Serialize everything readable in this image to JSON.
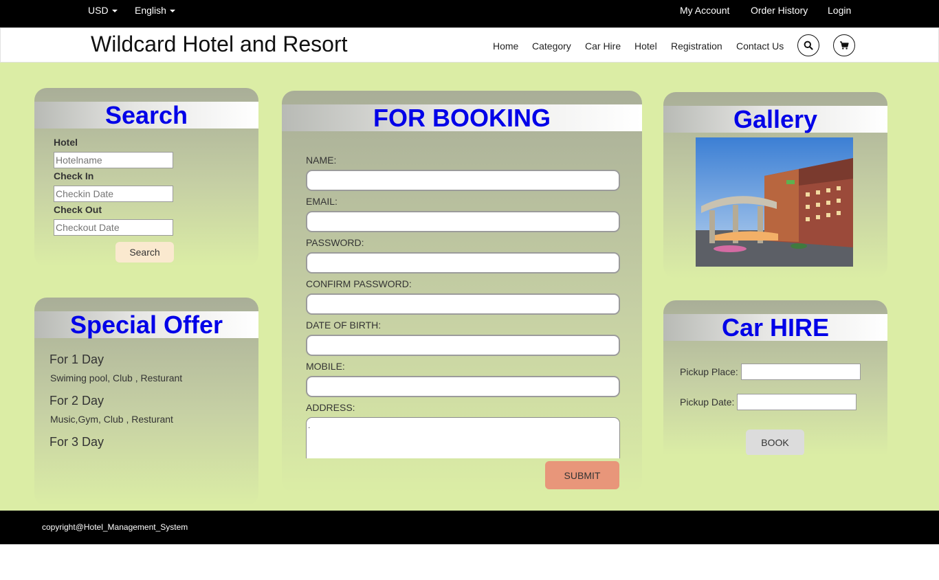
{
  "topbar": {
    "currency": "USD",
    "language": "English",
    "my_account": "My Account",
    "order_history": "Order History",
    "login": "Login"
  },
  "header": {
    "brand": "Wildcard Hotel and Resort",
    "nav": [
      "Home",
      "Category",
      "Car Hire",
      "Hotel",
      "Registration",
      "Contact Us"
    ]
  },
  "search_panel": {
    "title": "Search",
    "hotel_label": "Hotel",
    "hotel_placeholder": "Hotelname",
    "checkin_label": "Check In",
    "checkin_placeholder": "Checkin Date",
    "checkout_label": "Check Out",
    "checkout_placeholder": "Checkout Date",
    "button": "Search"
  },
  "special_offer": {
    "title": "Special Offer",
    "offers": [
      {
        "heading": "For 1 Day",
        "detail": "Swiming pool, Club , Resturant"
      },
      {
        "heading": "For 2 Day",
        "detail": "Music,Gym, Club , Resturant"
      },
      {
        "heading": "For 3 Day",
        "detail": ""
      }
    ]
  },
  "booking": {
    "title": "FOR BOOKING",
    "fields": [
      "NAME:",
      "EMAIL:",
      "PASSWORD:",
      "CONFIRM PASSWORD:",
      "DATE OF BIRTH:",
      "MOBILE:"
    ],
    "address_label": "ADDRESS:",
    "submit": "SUBMIT"
  },
  "gallery": {
    "title": "Gallery"
  },
  "car_hire": {
    "title": "Car HIRE",
    "pickup_place_label": "Pickup Place:",
    "pickup_date_label": "Pickup Date:",
    "button": "BOOK"
  },
  "footer": {
    "copyright": "copyright@Hotel_Management_System"
  },
  "colors": {
    "page_background": "#dbeda5",
    "title_text": "#0000e8",
    "submit_button": "#e8967a",
    "search_button": "#fae9cf"
  },
  "icons": [
    "search-icon",
    "cart-icon",
    "caret-down-icon"
  ]
}
